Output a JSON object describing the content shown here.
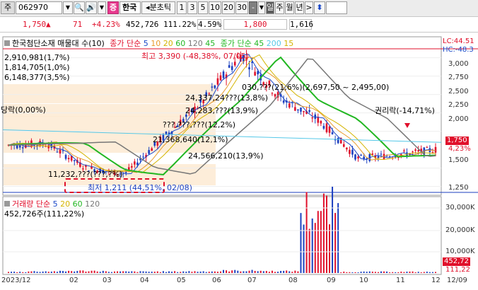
{
  "toolbar": {
    "menu_label": "주",
    "code": "062970",
    "pink_label": "증",
    "name": "한국",
    "mode": "분초틱",
    "periods": [
      "1",
      "3",
      "5",
      "10",
      "20",
      "30"
    ],
    "selected_period": "-",
    "units": [
      "일",
      "주",
      "월",
      "년"
    ]
  },
  "info": {
    "price": "1,750",
    "arrow": "▲",
    "change": "71",
    "rate": "+4.23%",
    "volume": "452,726",
    "vol_ratio": "111.22%",
    "turnover": "4.59%",
    "ask": "1,800",
    "bid": "1,616"
  },
  "legend": {
    "title": "한국첨단소재 매물대 수(10)",
    "ma_title": "종가 단순",
    "ma_values": [
      "5",
      "10",
      "20",
      "60",
      "120",
      "45"
    ],
    "ma2_title": "종가 단순 45",
    "ma2_values": [
      "200",
      "15"
    ],
    "lc": "LC:44.51",
    "hc": "HC:-48.3"
  },
  "volume_legend": {
    "title": "거래량 단순",
    "values": [
      "5",
      "20",
      "60",
      "120"
    ],
    "current": "452,726주(111,22%)"
  },
  "annotations": {
    "high": "최고 3,390 (-48,38%, 07/05)",
    "low": "최저 1,211 (44,51%, 02/08)",
    "rights": "권리락(-14,71%)",
    "left_event": "당락(0,00%)",
    "vp1": "2,910,981(1,7%)",
    "vp2": "1,814,705(1,0%)",
    "vp3": "6,148,377(3,5%)",
    "vp4": "24,337,24???(13,8%)",
    "vp5": "24,283,???(13,9%)",
    "vp6": "???,???,???(12,2%)",
    "vp7": "21,368,640(12,1%)",
    "vp8": "24,566,210(13,9%)",
    "vp9": "11,232,???(???,?%)",
    "range": "030,???(21,6%)(2,697,50 ~ 2,495,00)"
  },
  "price_axis": [
    "3,000",
    "2,750",
    "2,500",
    "2,250",
    "2,000",
    "1,750",
    "1,500",
    "1,250"
  ],
  "price_tags": {
    "current": "1,750",
    "rate": "4,23%"
  },
  "volume_axis": [
    "30,000K",
    "20,000K",
    "10,000K"
  ],
  "volume_tags": {
    "current": "452,72",
    "ratio": "111,22"
  },
  "x_axis": [
    "2023/12",
    "02",
    "03",
    "04",
    "05",
    "06",
    "07",
    "08",
    "09",
    "10",
    "11",
    "12",
    "12/09"
  ],
  "colors": {
    "up": "#e0102b",
    "down": "#1b3fbf",
    "ma5": "#1b48c8",
    "ma10": "#e89a2a",
    "ma20": "#d4b400",
    "ma60": "#22b722",
    "ma120": "#777777",
    "ma200": "#55c8e8"
  },
  "chart_data": {
    "type": "line",
    "x": [
      "2023/12",
      "02",
      "03",
      "04",
      "05",
      "06",
      "07",
      "08",
      "09",
      "10",
      "11",
      "12"
    ],
    "series": [
      {
        "name": "종가",
        "values": [
          1810,
          1830,
          1500,
          1420,
          1920,
          2400,
          3050,
          2450,
          2150,
          1630,
          1680,
          1750
        ]
      }
    ],
    "ylim": [
      1150,
      3150
    ],
    "volume": [
      0.5,
      0.7,
      0.9,
      0.6,
      0.6,
      0.7,
      1.0,
      0.8,
      27.0,
      0.5,
      0.5,
      0.45
    ]
  }
}
